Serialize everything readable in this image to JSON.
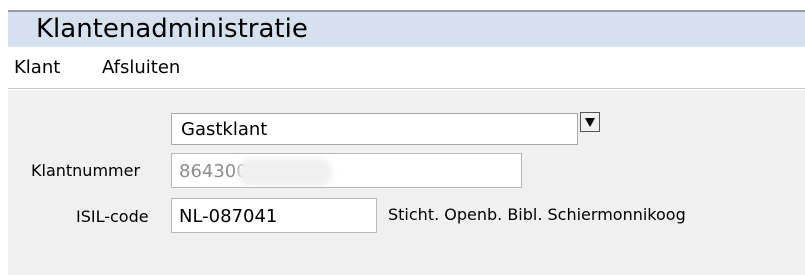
{
  "window": {
    "title": "Klantenadministratie"
  },
  "menu": {
    "items": [
      {
        "label": "Klant"
      },
      {
        "label": "Afsluiten"
      }
    ]
  },
  "form": {
    "customer_type": {
      "selected_value": "Gastklant"
    },
    "customer_number": {
      "label": "Klantnummer",
      "value": "864300"
    },
    "isil_code": {
      "label": "ISIL-code",
      "value": "NL-087041"
    },
    "library_name": "Sticht. Openb. Bibl. Schiermonnikoog"
  },
  "icons": {
    "dropdown": "triangle-down-icon"
  },
  "colors": {
    "title_bar": "#d6e1ef",
    "content_background": "#f0f0f0",
    "window_background": "#ffffff",
    "input_border": "#b9b9b9",
    "readonly_text": "#8d8d8d"
  }
}
